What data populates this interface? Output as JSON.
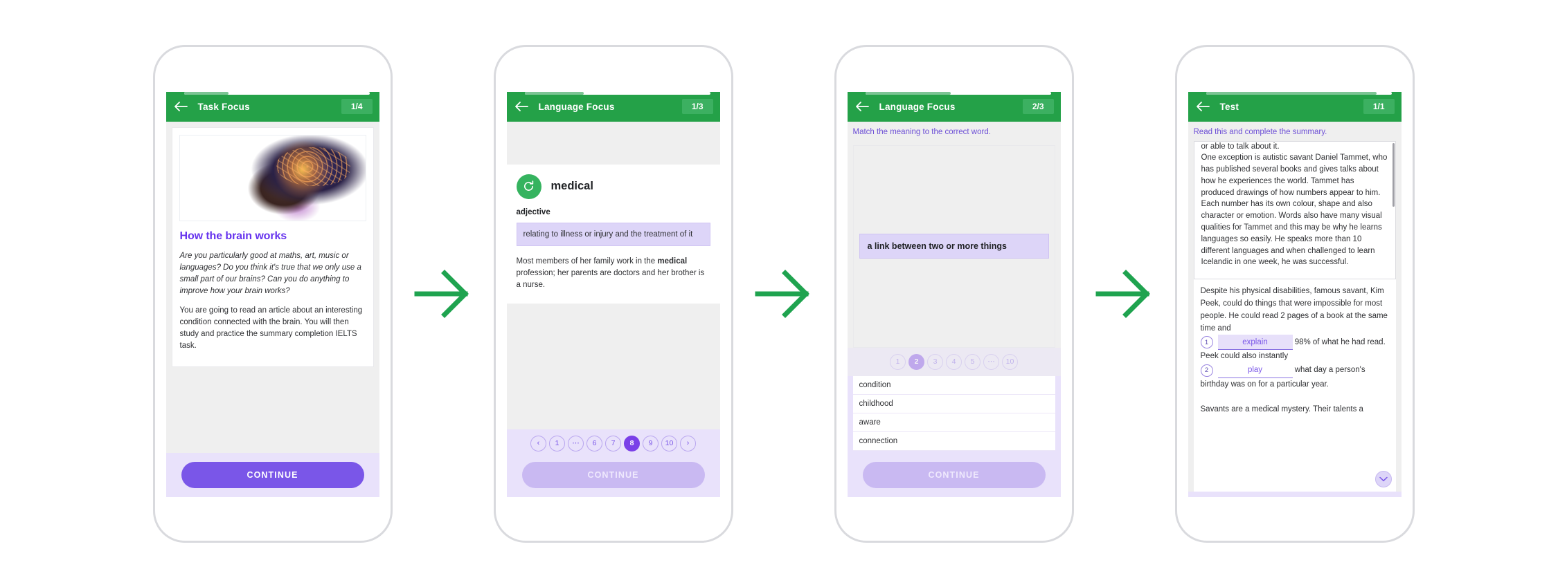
{
  "accent": {
    "green": "#24a148",
    "purple": "#7a56e8",
    "purple_text": "#6633ee",
    "light_purple_bg": "#e9e2fb"
  },
  "continue_label": "CONTINUE",
  "icons": {
    "back": "back-arrow-icon",
    "audio": "replay-audio-icon",
    "prev": "‹",
    "next": "›",
    "ellipsis": "⋯",
    "chevron_down": "chevron-down-icon"
  },
  "screens": [
    {
      "id": "task-focus",
      "title": "Task Focus",
      "counter": "1/4",
      "progress_percent": 24,
      "card": {
        "image_name": "brain-illustration",
        "title": "How the brain works",
        "paragraphs": [
          {
            "style": "italic",
            "text": "Are you particularly good at maths, art, music or languages? Do you think it's true that we only use a small part of our brains? Can you do anything to improve how your brain works?"
          },
          {
            "style": "normal",
            "text": "You are going to read an article about an interesting condition connected with the brain. You will then study and practice the summary completion IELTS task."
          }
        ]
      },
      "continue_enabled": true
    },
    {
      "id": "language-focus-1",
      "title": "Language Focus",
      "counter": "1/3",
      "progress_percent": 32,
      "word_card": {
        "word": "medical",
        "part_of_speech": "adjective",
        "definition": "relating to illness or injury and the treatment of it",
        "example_before": "Most members of her family work in the ",
        "example_bold": "medical",
        "example_after": " profession; her parents are doctors and her brother is a nurse."
      },
      "pager": {
        "items": [
          "‹",
          "1",
          "⋯",
          "6",
          "7",
          "8",
          "9",
          "10",
          "›"
        ],
        "active_index": 5,
        "faded": false
      },
      "continue_enabled": false
    },
    {
      "id": "language-focus-2",
      "title": "Language Focus",
      "counter": "2/3",
      "progress_percent": 46,
      "instruction": "Match the meaning to the correct word.",
      "match": {
        "prompt": "a link between two or more things",
        "options": [
          "condition",
          "childhood",
          "aware",
          "connection"
        ]
      },
      "pager": {
        "items": [
          "1",
          "2",
          "3",
          "4",
          "5",
          "⋯",
          "10"
        ],
        "active_index": 1,
        "faded": true
      },
      "continue_enabled": false
    },
    {
      "id": "test",
      "title": "Test",
      "counter": "1/1",
      "progress_percent": 92,
      "instruction": "Read this and complete the summary.",
      "reading": {
        "clipped_line": "or able to talk about it.",
        "paragraph": "One exception is autistic savant Daniel Tammet, who has published several books and gives talks about how he experiences the world. Tammet has produced drawings of how numbers appear to him. Each number has its own colour, shape and also character or emotion. Words also have many visual qualities for Tammet and this may be why he learns languages so easily. He speaks more than 10 different languages and when challenged to learn Icelandic in one week, he was successful."
      },
      "summary": {
        "intro": "Despite his physical disabilities, famous savant, Kim Peek, could do things that were impossible for most people. He could read 2 pages of a book at the same time and",
        "blank_1": {
          "number": "1",
          "value": "explain"
        },
        "after_1": "98% of what he had read. Peek could also instantly",
        "blank_2": {
          "number": "2",
          "value": "play"
        },
        "after_2": "what day a person's birthday was on for a particular year.",
        "tail": "Savants are a medical mystery. Their talents a"
      }
    }
  ]
}
